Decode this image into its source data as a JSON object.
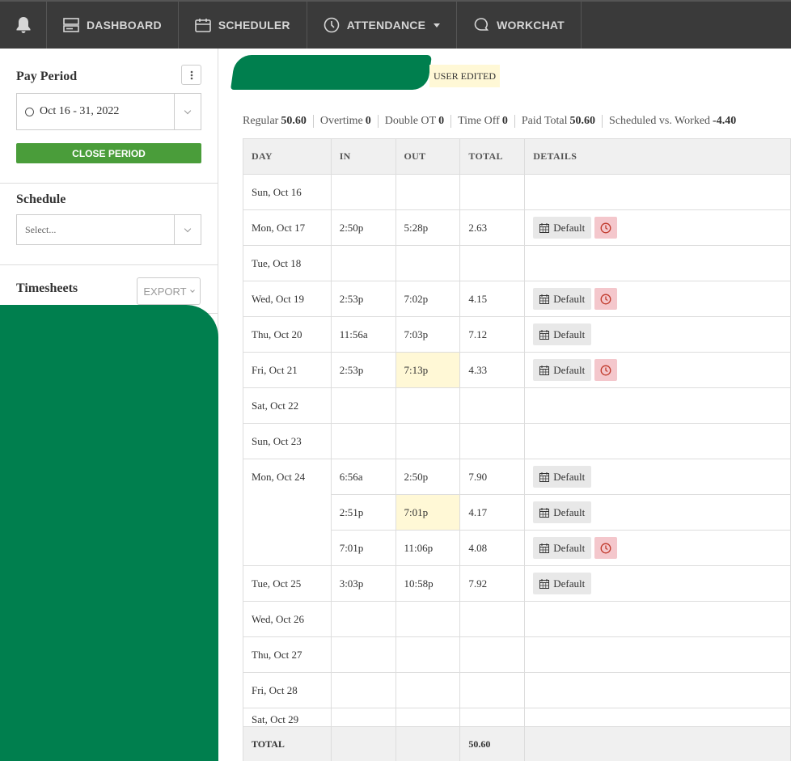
{
  "nav": {
    "items": [
      {
        "label": "DASHBOARD",
        "icon": "dashboard-icon"
      },
      {
        "label": "SCHEDULER",
        "icon": "calendar-icon"
      },
      {
        "label": "ATTENDANCE",
        "icon": "clock-icon"
      },
      {
        "label": "WORKCHAT",
        "icon": "chat-icon"
      }
    ]
  },
  "sidebar": {
    "pay_period_title": "Pay Period",
    "pay_period_value": "Oct 16 - 31, 2022",
    "close_period_label": "CLOSE PERIOD",
    "schedule_title": "Schedule",
    "schedule_placeholder": "Select...",
    "timesheets_title": "Timesheets",
    "export_label": "EXPORT"
  },
  "header": {
    "badge": "USER EDITED"
  },
  "summary": [
    {
      "label": "Regular",
      "value": "50.60"
    },
    {
      "label": "Overtime",
      "value": "0"
    },
    {
      "label": "Double OT",
      "value": "0"
    },
    {
      "label": "Time Off",
      "value": "0"
    },
    {
      "label": "Paid Total",
      "value": "50.60"
    },
    {
      "label": "Scheduled vs. Worked",
      "value": "-4.40"
    }
  ],
  "table": {
    "headers": [
      "DAY",
      "IN",
      "OUT",
      "TOTAL",
      "DETAILS"
    ],
    "default_label": "Default",
    "rows": [
      {
        "day": "Sun, Oct 16",
        "shifts": []
      },
      {
        "day": "Mon, Oct 17",
        "shifts": [
          {
            "in": "2:50p",
            "out": "5:28p",
            "total": "2.63",
            "clock": true
          }
        ]
      },
      {
        "day": "Tue, Oct 18",
        "shifts": []
      },
      {
        "day": "Wed, Oct 19",
        "shifts": [
          {
            "in": "2:53p",
            "out": "7:02p",
            "total": "4.15",
            "clock": true
          }
        ]
      },
      {
        "day": "Thu, Oct 20",
        "shifts": [
          {
            "in": "11:56a",
            "out": "7:03p",
            "total": "7.12",
            "clock": false
          }
        ]
      },
      {
        "day": "Fri, Oct 21",
        "shifts": [
          {
            "in": "2:53p",
            "out": "7:13p",
            "total": "4.33",
            "clock": true,
            "out_edited": true
          }
        ]
      },
      {
        "day": "Sat, Oct 22",
        "shifts": []
      },
      {
        "day": "Sun, Oct 23",
        "shifts": []
      },
      {
        "day": "Mon, Oct 24",
        "shifts": [
          {
            "in": "6:56a",
            "out": "2:50p",
            "total": "7.90",
            "clock": false
          },
          {
            "in": "2:51p",
            "out": "7:01p",
            "total": "4.17",
            "clock": false,
            "out_edited": true
          },
          {
            "in": "7:01p",
            "out": "11:06p",
            "total": "4.08",
            "clock": true
          }
        ]
      },
      {
        "day": "Tue, Oct 25",
        "shifts": [
          {
            "in": "3:03p",
            "out": "10:58p",
            "total": "7.92",
            "clock": false
          }
        ]
      },
      {
        "day": "Wed, Oct 26",
        "shifts": []
      },
      {
        "day": "Thu, Oct 27",
        "shifts": []
      },
      {
        "day": "Fri, Oct 28",
        "shifts": []
      },
      {
        "day": "Sat, Oct 29",
        "shifts": []
      }
    ],
    "footer": {
      "label": "TOTAL",
      "total": "50.60"
    }
  }
}
